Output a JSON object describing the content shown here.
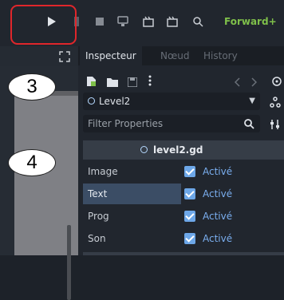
{
  "toolbar": {
    "icons": [
      "play-icon",
      "pause-icon",
      "stop-icon",
      "remote-debug-icon",
      "movie-maker-icon",
      "movie-maker-icon",
      "search-icon"
    ],
    "renderer_label": "Forward+"
  },
  "annotations": {
    "badge_3": "3",
    "badge_4": "4"
  },
  "inspector": {
    "tabs": [
      {
        "label": "Inspecteur",
        "active": true
      },
      {
        "label": "Nœud",
        "active": false
      },
      {
        "label": "History",
        "active": false
      }
    ],
    "node_select": {
      "value": "Level2"
    },
    "filter": {
      "placeholder": "Filter Properties"
    },
    "script_section": {
      "title": "level2.gd"
    },
    "properties": [
      {
        "name": "Image",
        "value": "Activé",
        "checked": true,
        "selected": false
      },
      {
        "name": "Text",
        "value": "Activé",
        "checked": true,
        "selected": true
      },
      {
        "name": "Prog",
        "value": "Activé",
        "checked": true,
        "selected": false
      },
      {
        "name": "Son",
        "value": "Activé",
        "checked": true,
        "selected": false
      }
    ]
  },
  "colors": {
    "accent": "#7aaeef",
    "checkbox": "#6da7e8",
    "renderer": "#7fc04a",
    "highlight": "#e0262b"
  }
}
